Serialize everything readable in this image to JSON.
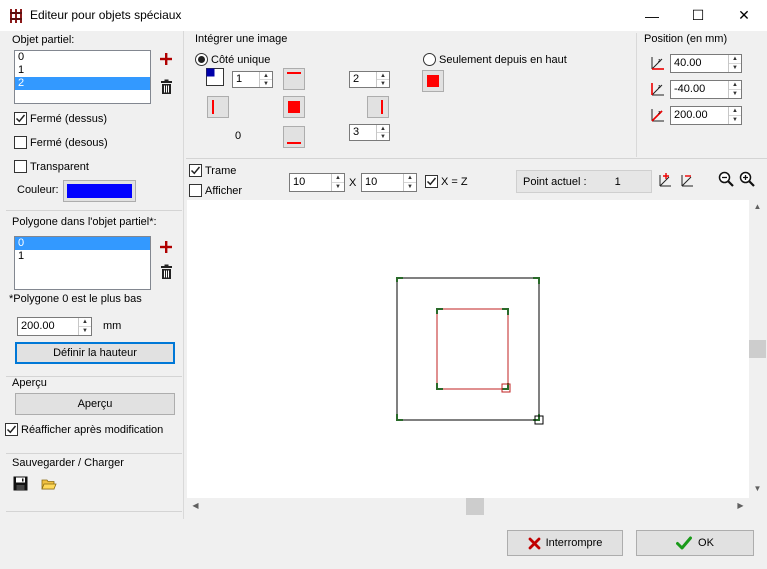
{
  "window": {
    "title": "Editeur pour objets spéciaux",
    "minimize_glyph": "—",
    "maximize_glyph": "☐",
    "close_glyph": "✕"
  },
  "partial_object": {
    "label": "Objet partiel:",
    "items": [
      "0",
      "1",
      "2"
    ],
    "selected_index": 2,
    "closed_top_label": "Fermé (dessus)",
    "closed_top_checked": true,
    "closed_bottom_label": "Fermé (desous)",
    "closed_bottom_checked": false,
    "transparent_label": "Transparent",
    "transparent_checked": false,
    "color_label": "Couleur:",
    "color_value": "#0000ff"
  },
  "polygon": {
    "label": "Polygone dans l'objet partiel*:",
    "items": [
      "0",
      "1"
    ],
    "selected_index": 0,
    "note": "*Polygone 0 est le plus bas",
    "height_value": "200.00",
    "height_unit": "mm",
    "define_height_label": "Définir la hauteur"
  },
  "preview": {
    "label": "Aperçu",
    "button_label": "Aperçu",
    "refresh_label": "Réafficher après modification",
    "refresh_checked": true
  },
  "save_load": {
    "label": "Sauvegarder / Charger",
    "save_icon": "floppy-disk-icon",
    "open_icon": "folder-open-icon"
  },
  "integrate_image": {
    "label": "Intégrer une image",
    "single_side_label": "Côté unique",
    "single_side_selected": true,
    "from_top_label": "Seulement depuis en haut",
    "from_top_selected": false,
    "spin_left": "1",
    "spin_top_right": "2",
    "spin_bottom_right": "3",
    "bottom_value": "0",
    "accent": "#ff0000"
  },
  "position": {
    "label": "Position (en mm)",
    "x": "40.00",
    "y": "-40.00",
    "z": "200.00"
  },
  "toolbar": {
    "grid_label": "Trame",
    "grid_checked": true,
    "show_label": "Afficher",
    "show_checked": false,
    "grid_x": "10",
    "times_label": "X",
    "grid_y": "10",
    "x_eq_z_label": "X = Z",
    "x_eq_z_checked": true,
    "current_point_label": "Point actuel :",
    "current_point_value": "1"
  },
  "footer": {
    "cancel_label": "Interrompre",
    "ok_label": "OK",
    "cancel_color": "#c00000",
    "ok_color": "#1a9a1a"
  }
}
